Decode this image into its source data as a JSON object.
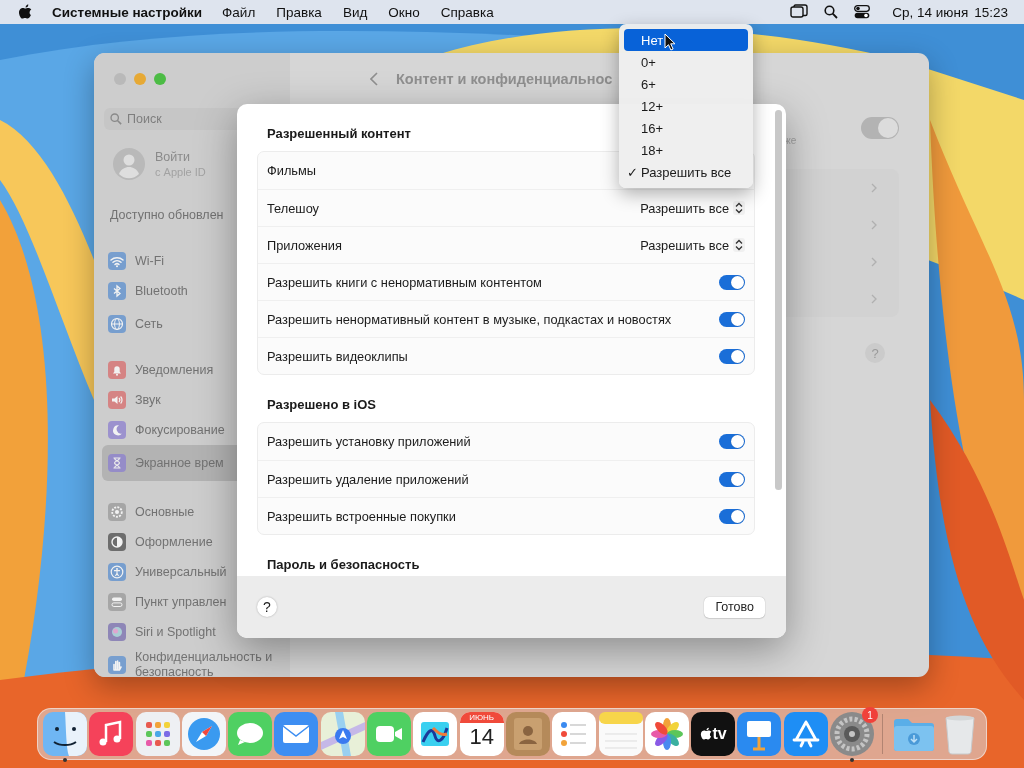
{
  "menu_bar": {
    "app_name": "Системные настройки",
    "menus": [
      "Файл",
      "Правка",
      "Вид",
      "Окно",
      "Справка"
    ],
    "date": "Ср, 14 июня",
    "time": "15:23"
  },
  "window": {
    "title": "Контент и конфиденциальнос",
    "sidebar": {
      "search_placeholder": "Поиск",
      "account": {
        "name": "Войти",
        "subtitle": "с Apple ID"
      },
      "update_notice": "Доступно обновлен",
      "groups": [
        {
          "items": [
            {
              "label": "Wi-Fi",
              "selected": false
            },
            {
              "label": "Bluetooth",
              "selected": false
            },
            {
              "label": "Сеть",
              "selected": false
            }
          ]
        },
        {
          "items": [
            {
              "label": "Уведомления",
              "selected": false
            },
            {
              "label": "Звук",
              "selected": false
            },
            {
              "label": "Фокусирование",
              "selected": false
            },
            {
              "label": "Экранное врем",
              "selected": true
            }
          ]
        },
        {
          "items": [
            {
              "label": "Основные",
              "selected": false
            },
            {
              "label": "Оформление",
              "selected": false
            },
            {
              "label": "Универсальный",
              "selected": false
            },
            {
              "label": "Пункт управлен",
              "selected": false
            },
            {
              "label": "Siri и Spotlight",
              "selected": false
            },
            {
              "label": "Конфиденциальность и безопасность",
              "selected": false
            }
          ]
        }
      ]
    },
    "content": {
      "toggle": {
        "on": true
      },
      "fragment_text": "же"
    }
  },
  "sheet": {
    "sections": [
      {
        "title": "Разрешенный контент",
        "rows": [
          {
            "kind": "popup",
            "label": "Фильмы"
          },
          {
            "kind": "popup",
            "label": "Телешоу",
            "value": "Разрешить все"
          },
          {
            "kind": "popup",
            "label": "Приложения",
            "value": "Разрешить все"
          },
          {
            "kind": "toggle",
            "label": "Разрешить книги с ненормативным контентом",
            "on": true
          },
          {
            "kind": "toggle",
            "label": "Разрешить ненормативный контент в музыке, подкастах и новостях",
            "on": true
          },
          {
            "kind": "toggle",
            "label": "Разрешить видеоклипы",
            "on": true
          }
        ]
      },
      {
        "title": "Разрешено в iOS",
        "rows": [
          {
            "kind": "toggle",
            "label": "Разрешить установку приложений",
            "on": true
          },
          {
            "kind": "toggle",
            "label": "Разрешить удаление приложений",
            "on": true
          },
          {
            "kind": "toggle",
            "label": "Разрешить встроенные покупки",
            "on": true
          }
        ]
      },
      {
        "title": "Пароль и безопасность"
      }
    ],
    "help_label": "?",
    "done_button": "Готово"
  },
  "popup_menu": {
    "items": [
      {
        "label": "Нет",
        "selected": true,
        "checked": false
      },
      {
        "label": "0+",
        "selected": false,
        "checked": false
      },
      {
        "label": "6+",
        "selected": false,
        "checked": false
      },
      {
        "label": "12+",
        "selected": false,
        "checked": false
      },
      {
        "label": "16+",
        "selected": false,
        "checked": false
      },
      {
        "label": "18+",
        "selected": false,
        "checked": false
      },
      {
        "label": "Разрешить все",
        "selected": false,
        "checked": true
      }
    ],
    "check_mark": "✓"
  },
  "dock": {
    "items": [
      {
        "running": true
      },
      {
        "running": false
      },
      {
        "running": false
      },
      {
        "running": false
      },
      {
        "running": false
      },
      {
        "running": false
      },
      {
        "running": false
      },
      {
        "running": false
      },
      {
        "running": false
      },
      {
        "running": false,
        "label": "ИЮНЬ",
        "sublabel": "14"
      },
      {
        "running": false
      },
      {
        "running": false
      },
      {
        "running": false
      },
      {
        "running": false
      },
      {
        "running": false,
        "label": "tv"
      },
      {
        "running": false
      },
      {
        "running": false
      },
      {
        "running": true,
        "badge": "1"
      },
      {
        "running": false
      },
      {
        "running": false
      }
    ]
  }
}
